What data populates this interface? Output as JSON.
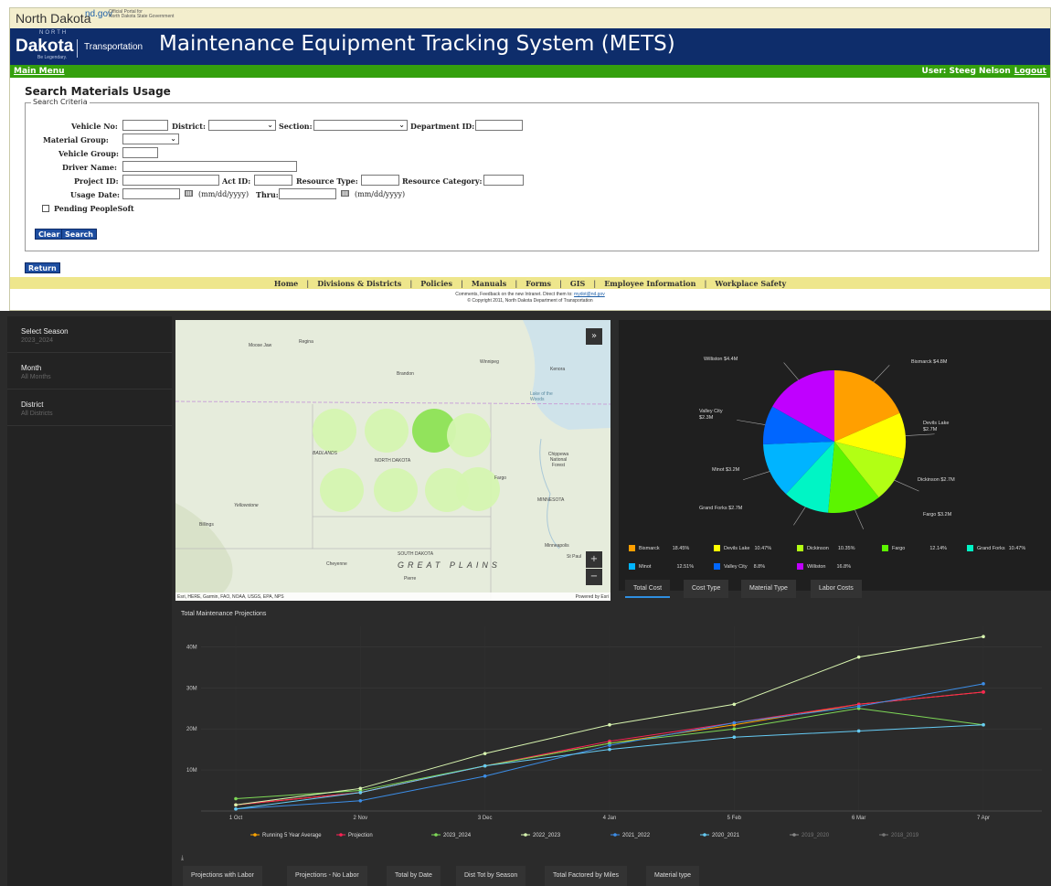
{
  "mets": {
    "brand": "North Dakota",
    "gov_domain": "nd.gov",
    "official_line1": "Official Portal for",
    "official_line2": "North Dakota State Government",
    "logo_small": "NORTH",
    "logo": "Dakota",
    "tagline": "Be Legendary.",
    "dept": "Transportation",
    "title": "Maintenance Equipment Tracking System (METS)",
    "main_menu": "Main Menu",
    "user_label": "User: Steeg Nelson",
    "logout": "Logout",
    "page_heading": "Search Materials Usage",
    "fieldset_legend": "Search Criteria",
    "labels": {
      "vehicle_no": "Vehicle No:",
      "district": "District:",
      "section": "Section:",
      "department_id": "Department ID:",
      "material_group": "Material Group:",
      "vehicle_group": "Vehicle Group:",
      "driver_name": "Driver Name:",
      "project_id": "Project ID:",
      "act_id": "Act ID:",
      "resource_type": "Resource Type:",
      "resource_category": "Resource Category:",
      "usage_date": "Usage Date:",
      "date_format": "(mm/dd/yyyy)",
      "thru": "Thru:",
      "pending": "Pending PeopleSoft"
    },
    "buttons": {
      "clear": "Clear",
      "search": "Search",
      "return": "Return"
    },
    "footer_nav": [
      "Home",
      "Divisions & Districts",
      "Policies",
      "Manuals",
      "Forms",
      "GIS",
      "Employee Information",
      "Workplace Safety"
    ],
    "comments_prefix": "Comments, Feedback on the new Intranet. Direct them to:",
    "comments_email": "mydot@nd.gov",
    "copyright": "© Copyright 2011, North Dakota Department of Transportation"
  },
  "dashboard": {
    "filters": [
      {
        "title": "Select Season",
        "value": "2023_2024"
      },
      {
        "title": "Month",
        "value": "All Months"
      },
      {
        "title": "District",
        "value": "All Districts"
      }
    ],
    "map": {
      "places": [
        "Moose Jaw",
        "Regina",
        "Brandon",
        "Winnipeg",
        "Kenora",
        "Lake of the Woods",
        "BADLANDS",
        "NORTH DAKOTA",
        "Chippewa National Forest",
        "Fargo",
        "MINNESOTA",
        "Billings",
        "Yellowstone",
        "SOUTH DAKOTA",
        "GREAT  PLAINS",
        "Pierre",
        "Minneapolis",
        "St Paul",
        "Cheyenne"
      ],
      "attribution": "Esri, HERE, Garmin, FAO, NOAA, USGS, EPA, NPS",
      "powered_by": "Powered by Esri",
      "collapse_icon": "chevron-double-down-icon",
      "zoom_in": "+",
      "zoom_out": "−"
    },
    "pie": {
      "slices": [
        {
          "name": "Bismarck",
          "label": "Bismarck $4.8M",
          "percent": 18.45,
          "color": "#ff9f00"
        },
        {
          "name": "Devils Lake",
          "label": "Devils Lake $2.7M",
          "percent": 10.47,
          "color": "#ffff00"
        },
        {
          "name": "Dickinson",
          "label": "Dickinson $2.7M",
          "percent": 10.35,
          "color": "#b2ff14"
        },
        {
          "name": "Fargo",
          "label": "Fargo $3.2M",
          "percent": 12.14,
          "color": "#5cf500"
        },
        {
          "name": "Grand Forks",
          "label": "Grand Forks $2.7M",
          "percent": 10.47,
          "color": "#00f5c5"
        },
        {
          "name": "Minot",
          "label": "Minot $3.2M",
          "percent": 12.51,
          "color": "#00b4ff"
        },
        {
          "name": "Valley City",
          "label": "Valley City $2.3M",
          "percent": 8.8,
          "color": "#0066ff"
        },
        {
          "name": "Williston",
          "label": "Williston $4.4M",
          "percent": 16.8,
          "color": "#c000ff"
        }
      ],
      "legend_pct": [
        "18.45%",
        "10.47%",
        "10.35%",
        "12.14%",
        "10.47%",
        "12.51%",
        "8.8%",
        "16.8%"
      ]
    },
    "tabs_top": [
      "Total Cost",
      "Cost Type",
      "Material Type",
      "Labor Costs"
    ],
    "tabs_bottom": [
      "Projections with Labor",
      "Projections - No Labor",
      "Total by Date",
      "Dist Tot by Season",
      "Total Factored by Miles",
      "Material type"
    ],
    "download_icon": "download-icon"
  },
  "chart_data": {
    "type": "line",
    "title": "Total Maintenance Projections",
    "x": [
      "1 Oct",
      "2 Nov",
      "3 Dec",
      "4 Jan",
      "5 Feb",
      "6 Mar",
      "7 Apr"
    ],
    "ylim": [
      0,
      45000000
    ],
    "yticks": [
      "10M",
      "20M",
      "30M",
      "40M"
    ],
    "ytick_values": [
      10000000,
      20000000,
      30000000,
      40000000
    ],
    "series": [
      {
        "name": "Running 5 Year Average",
        "color": "#ffa500",
        "values": [
          1500000,
          4500000,
          11000000,
          16500000,
          21000000,
          26000000,
          29000000
        ]
      },
      {
        "name": "Projection",
        "color": "#ff2255",
        "values": [
          1500000,
          4500000,
          11000000,
          17000000,
          21500000,
          26000000,
          29000000
        ]
      },
      {
        "name": "2023_2024",
        "color": "#7ed957",
        "values": [
          3000000,
          5000000,
          11000000,
          16500000,
          20000000,
          25000000,
          21000000
        ]
      },
      {
        "name": "2022_2023",
        "color": "#d8f5b0",
        "values": [
          1500000,
          5500000,
          14000000,
          21000000,
          26000000,
          37500000,
          42500000
        ]
      },
      {
        "name": "2021_2022",
        "color": "#3c8ee8",
        "values": [
          500000,
          2500000,
          8500000,
          16000000,
          21500000,
          25500000,
          31000000
        ]
      },
      {
        "name": "2020_2021",
        "color": "#66ccf5",
        "values": [
          500000,
          4500000,
          11000000,
          15000000,
          18000000,
          19500000,
          21000000
        ]
      },
      {
        "name": "2019_2020",
        "color": "#888888",
        "values": []
      },
      {
        "name": "2018_2019",
        "color": "#777777",
        "values": []
      }
    ]
  }
}
